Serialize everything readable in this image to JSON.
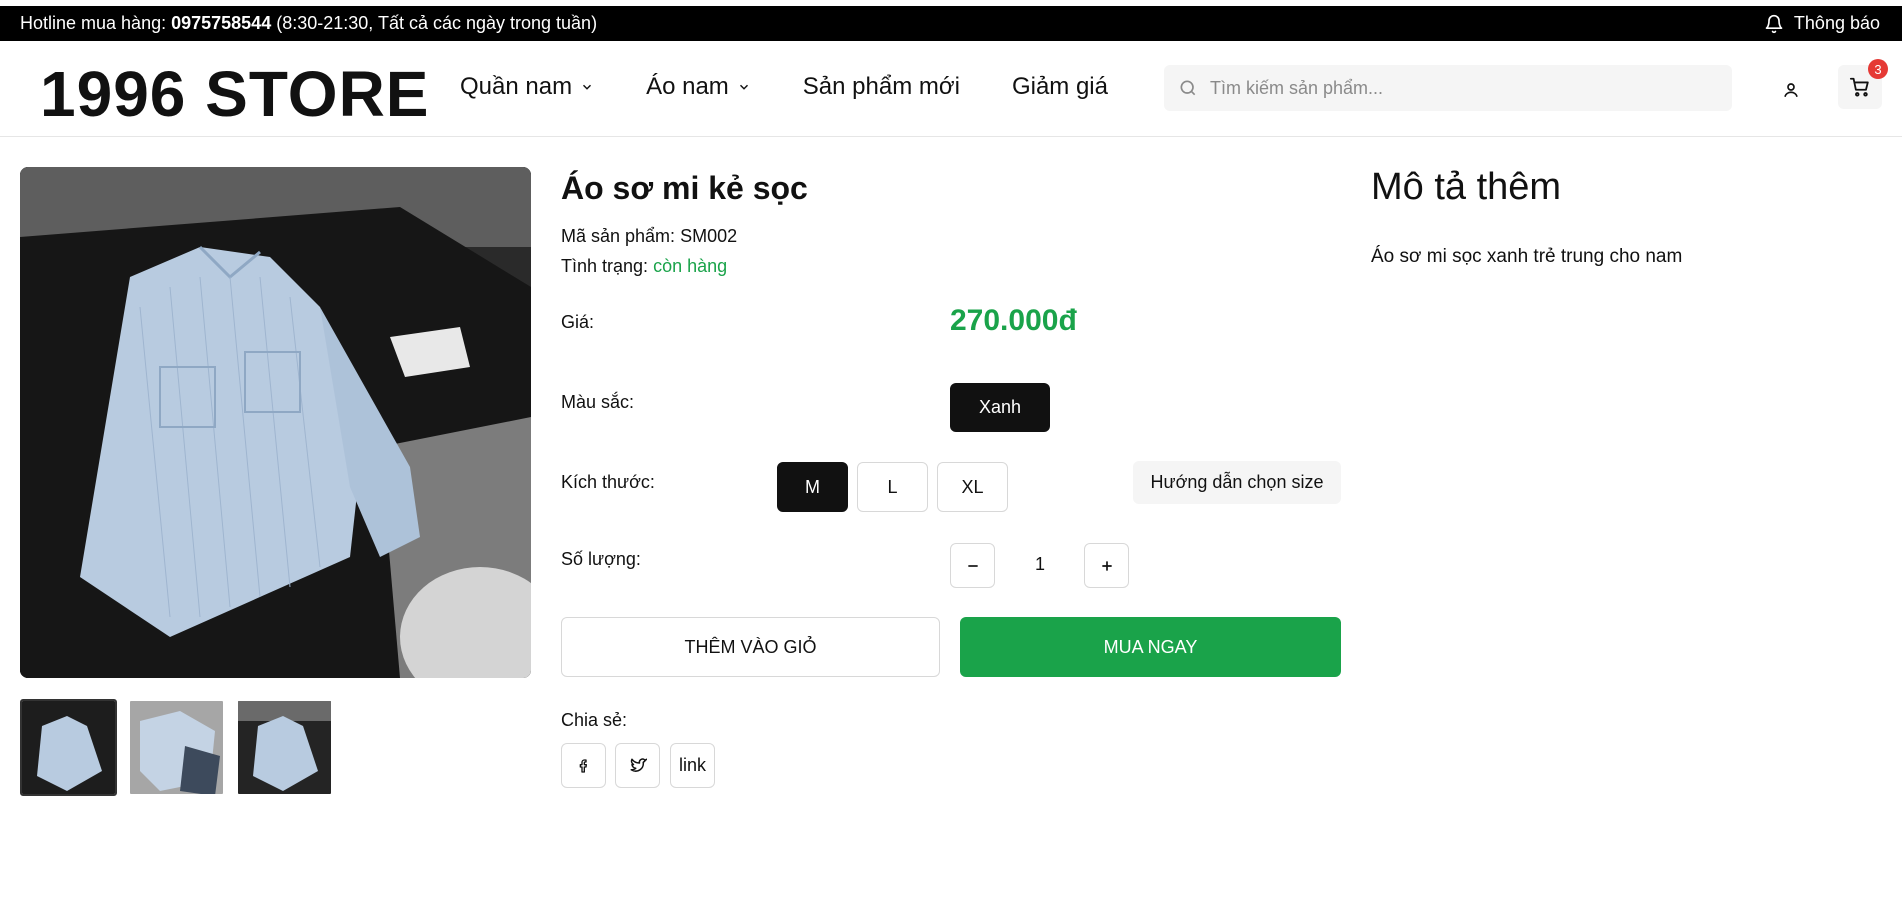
{
  "topbar": {
    "hotline_prefix": "Hotline mua hàng: ",
    "hotline_number": "0975758544",
    "hotline_suffix": " (8:30-21:30, Tất cả các ngày trong tuần)",
    "notify_label": "Thông báo",
    "notify_icon": "bell-icon"
  },
  "header": {
    "logo": "1996 STORE",
    "nav": [
      {
        "label": "Quần nam",
        "has_dropdown": true
      },
      {
        "label": "Áo nam",
        "has_dropdown": true
      },
      {
        "label": "Sản phẩm mới",
        "has_dropdown": false
      },
      {
        "label": "Giảm giá",
        "has_dropdown": false
      }
    ],
    "search": {
      "placeholder": "Tìm kiếm sản phẩm...",
      "value": ""
    },
    "cart_count": "3"
  },
  "product": {
    "title": "Áo sơ mi kẻ sọc",
    "sku_label": "Mã sản phẩm: ",
    "sku": "SM002",
    "status_label": "Tình trạng: ",
    "status": "còn hàng",
    "price_label": "Giá:",
    "price": "270.000đ",
    "color_label": "Màu sắc:",
    "color_selected": "Xanh",
    "size_label": "Kích thước:",
    "sizes": [
      "M",
      "L",
      "XL"
    ],
    "size_selected": "M",
    "size_guide": "Hướng dẫn chọn size",
    "qty_label": "Số lượng:",
    "qty": "1",
    "add_to_cart": "THÊM VÀO GIỎ",
    "buy_now": "MUA NGAY",
    "share_label": "Chia sẻ:",
    "share_link": "link"
  },
  "description": {
    "title": "Mô tả thêm",
    "text": "Áo sơ mi sọc xanh trẻ trung cho nam"
  },
  "colors": {
    "accent_green": "#1aa34a",
    "dark": "#111111",
    "badge_red": "#e53935"
  }
}
